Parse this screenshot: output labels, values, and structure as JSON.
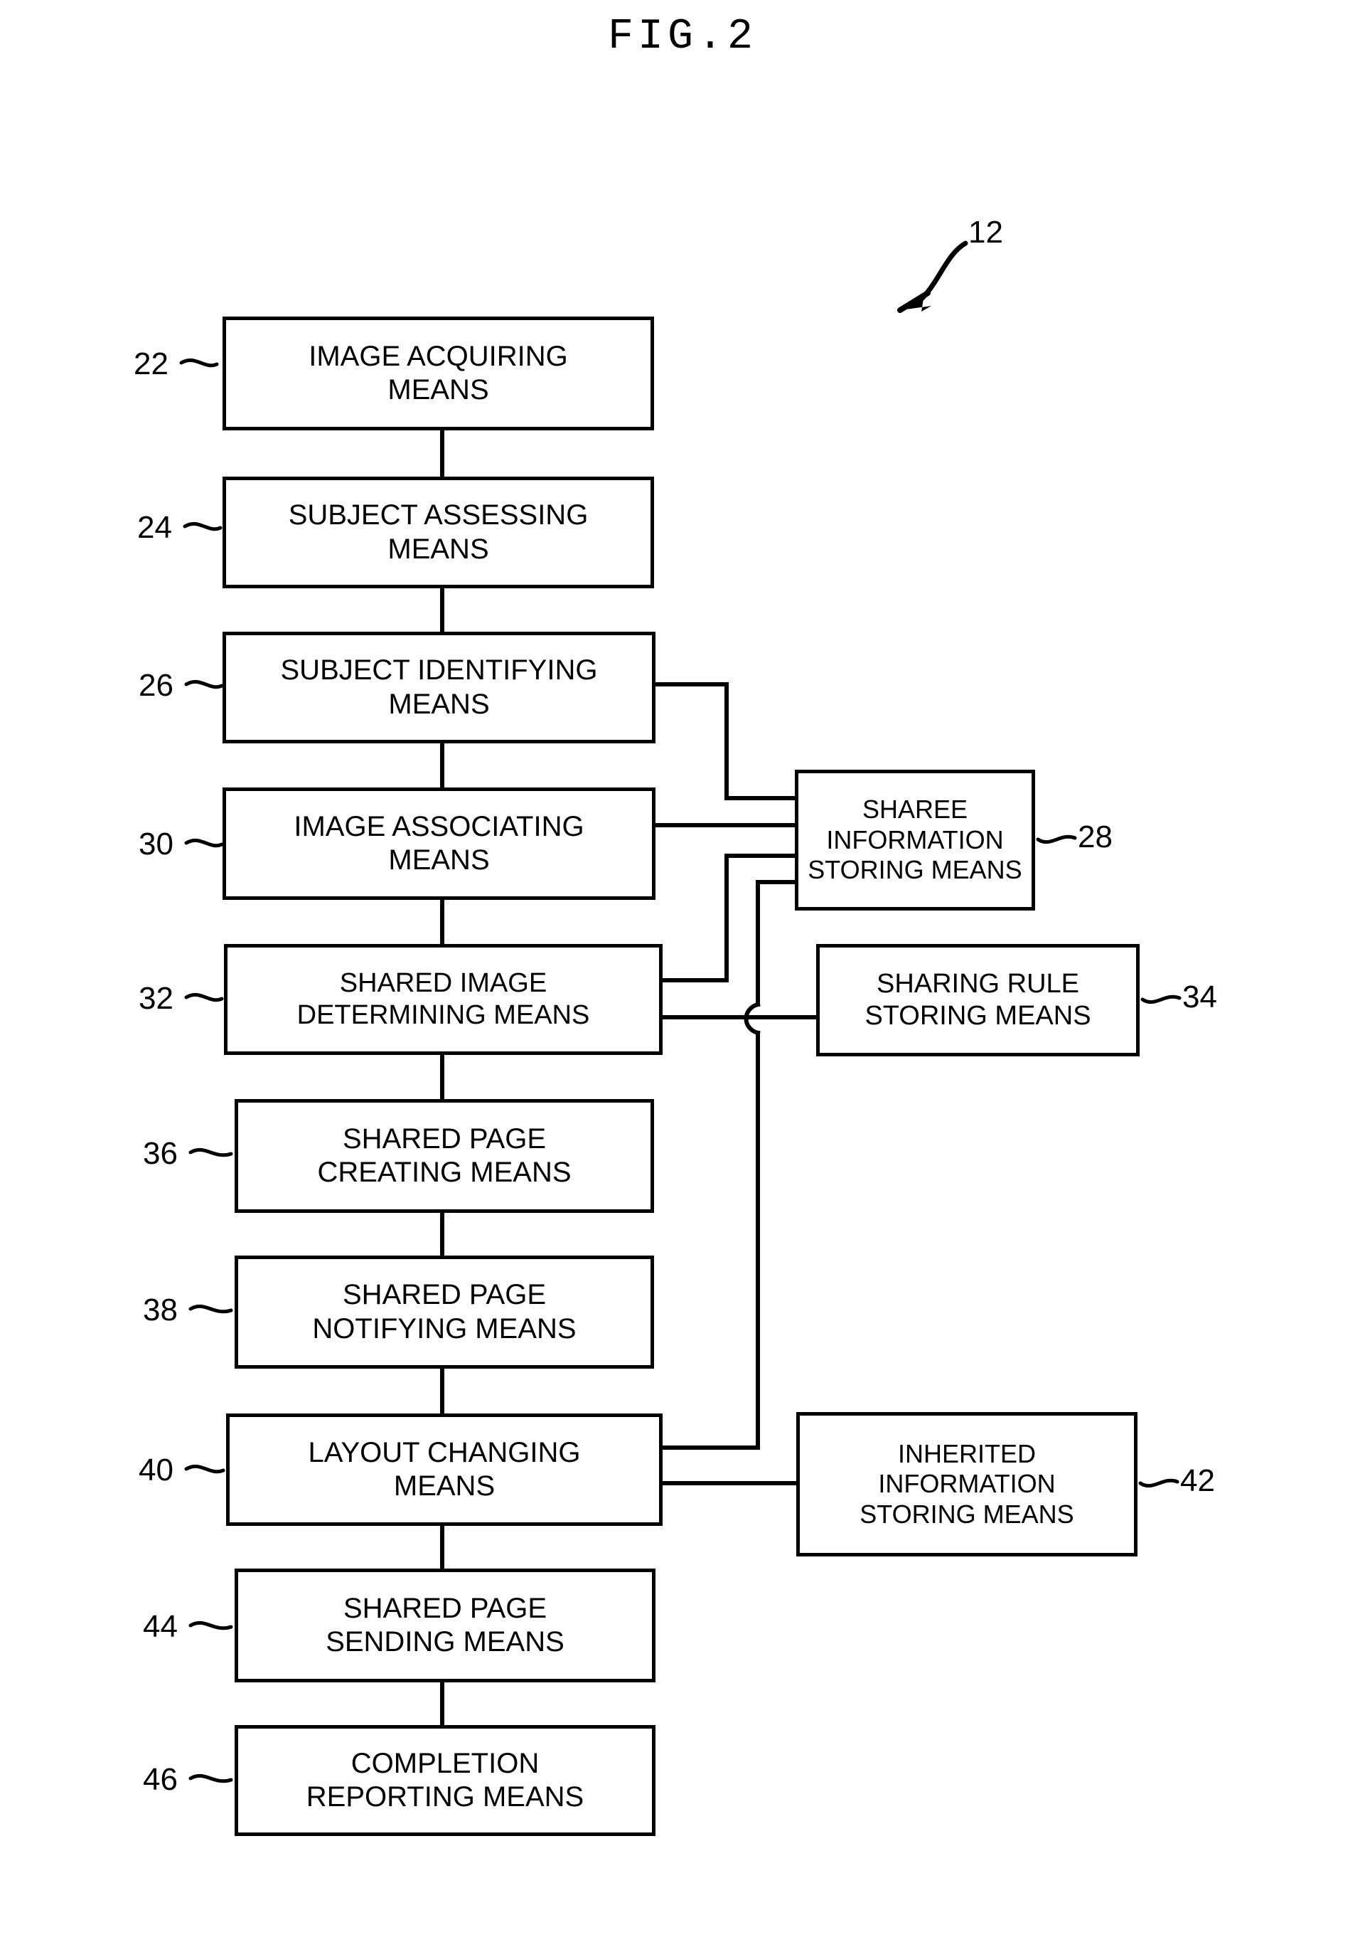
{
  "figure": {
    "title": "FIG.2",
    "system_ref": "12"
  },
  "nodes": [
    {
      "ref": "22",
      "lines": [
        "IMAGE ACQUIRING",
        "MEANS"
      ]
    },
    {
      "ref": "24",
      "lines": [
        "SUBJECT ASSESSING",
        "MEANS"
      ]
    },
    {
      "ref": "26",
      "lines": [
        "SUBJECT IDENTIFYING",
        "MEANS"
      ]
    },
    {
      "ref": "30",
      "lines": [
        "IMAGE ASSOCIATING",
        "MEANS"
      ]
    },
    {
      "ref": "32",
      "lines": [
        "SHARED IMAGE",
        "DETERMINING MEANS"
      ]
    },
    {
      "ref": "36",
      "lines": [
        "SHARED PAGE",
        "CREATING MEANS"
      ]
    },
    {
      "ref": "38",
      "lines": [
        "SHARED PAGE",
        "NOTIFYING MEANS"
      ]
    },
    {
      "ref": "40",
      "lines": [
        "LAYOUT CHANGING",
        "MEANS"
      ]
    },
    {
      "ref": "44",
      "lines": [
        "SHARED PAGE",
        "SENDING MEANS"
      ]
    },
    {
      "ref": "46",
      "lines": [
        "COMPLETION",
        "REPORTING MEANS"
      ]
    },
    {
      "ref": "28",
      "lines": [
        "SHAREE",
        "INFORMATION",
        "STORING MEANS"
      ]
    },
    {
      "ref": "34",
      "lines": [
        "SHARING RULE",
        "STORING MEANS"
      ]
    },
    {
      "ref": "42",
      "lines": [
        "INHERITED",
        "INFORMATION",
        "STORING MEANS"
      ]
    }
  ]
}
